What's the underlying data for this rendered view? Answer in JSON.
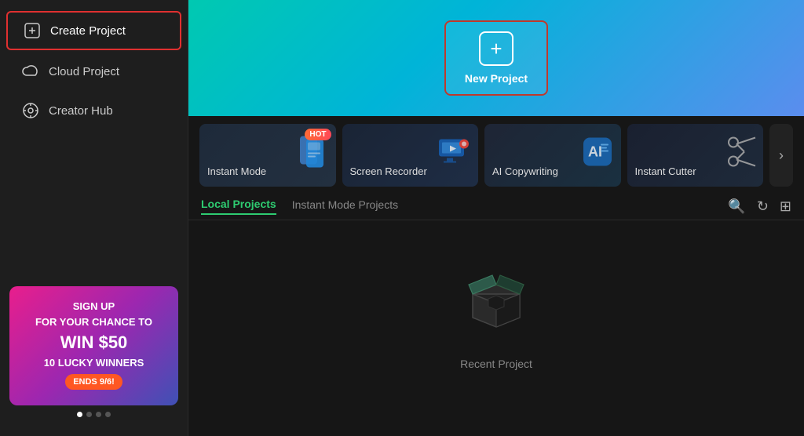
{
  "sidebar": {
    "items": [
      {
        "id": "create-project",
        "label": "Create Project",
        "icon": "⊕",
        "active": true
      },
      {
        "id": "cloud-project",
        "label": "Cloud Project",
        "icon": "☁",
        "active": false
      },
      {
        "id": "creator-hub",
        "label": "Creator Hub",
        "icon": "💡",
        "active": false
      }
    ]
  },
  "promo": {
    "line1": "SIGN UP",
    "line2": "FOR YOUR CHANCE TO",
    "win": "WIN $50",
    "line3": "10 LUCKY WINNERS",
    "badge": "ENDS 9/6!",
    "dots": [
      true,
      false,
      false,
      false
    ]
  },
  "hero": {
    "new_project_label": "New Project",
    "plus_symbol": "+"
  },
  "tools": [
    {
      "id": "instant-mode",
      "label": "Instant Mode",
      "icon": "📱",
      "hot": true
    },
    {
      "id": "screen-recorder",
      "label": "Screen Recorder",
      "icon": "🖥",
      "hot": false
    },
    {
      "id": "ai-copywriting",
      "label": "AI Copywriting",
      "icon": "🤖",
      "hot": false
    },
    {
      "id": "instant-cutter",
      "label": "Instant Cutter",
      "icon": "✂",
      "hot": false
    }
  ],
  "more_arrow": "›",
  "tabs": [
    {
      "id": "local-projects",
      "label": "Local Projects",
      "active": true
    },
    {
      "id": "instant-mode-projects",
      "label": "Instant Mode Projects",
      "active": false
    }
  ],
  "tab_icons": {
    "search": "🔍",
    "refresh": "↻",
    "layout": "⊞"
  },
  "empty_state": {
    "icon": "📦",
    "label": "Recent Project"
  }
}
